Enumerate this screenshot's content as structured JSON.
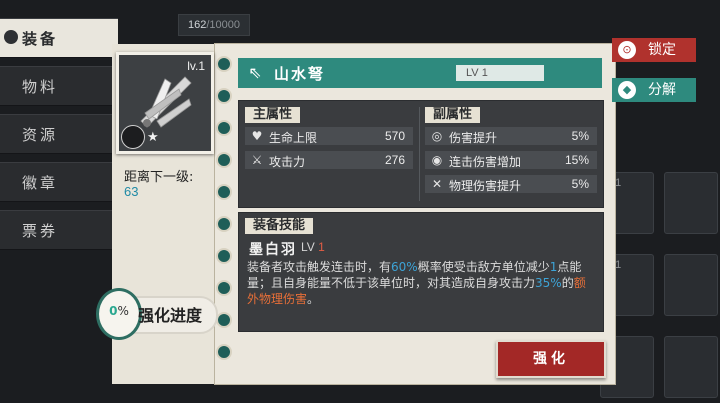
{
  "inventory": {
    "count": "162",
    "capacity": "/10000"
  },
  "sidebar": {
    "items": [
      {
        "label": "装备",
        "active": true
      },
      {
        "label": "物料"
      },
      {
        "label": "资源"
      },
      {
        "label": "徽章"
      },
      {
        "label": "票券"
      }
    ]
  },
  "item": {
    "card_level": "lv.1",
    "name": "山水弩",
    "level": "LV 1",
    "next_level_label": "距离下一级:",
    "next_level_value": "63"
  },
  "enhance_progress": {
    "percent": "0",
    "percent_sign": "%",
    "label": "强化进度"
  },
  "stats": {
    "main_title": "主属性",
    "sub_title": "副属性",
    "main": [
      {
        "icon": "heart-icon",
        "label": "生命上限",
        "value": "570"
      },
      {
        "icon": "swords-icon",
        "label": "攻击力",
        "value": "276"
      }
    ],
    "sub": [
      {
        "icon": "damage-boost-icon",
        "label": "伤害提升",
        "value": "5%"
      },
      {
        "icon": "combo-icon",
        "label": "连击伤害增加",
        "value": "15%"
      },
      {
        "icon": "physical-icon",
        "label": "物理伤害提升",
        "value": "5%"
      }
    ]
  },
  "skill": {
    "title": "装备技能",
    "name": "墨白羽",
    "lv_prefix": "LV ",
    "lv_num": "1",
    "desc_parts": {
      "p1": "装备者攻击触发连击时，有",
      "p2": "60%",
      "p3": "概率使受击敌方单位减少",
      "p4": "1",
      "p5": "点能量；且自身能量不低于该单位时，对其造成自身攻击力",
      "p6": "35%",
      "p7": "的",
      "p8": "额外物理伤害",
      "p9": "。"
    }
  },
  "buttons": {
    "enhance": "强化",
    "lock": "锁定",
    "decompose": "分解"
  },
  "background_slots": {
    "level_label": "lv.1"
  },
  "colors": {
    "teal": "#2e8a7e",
    "red": "#a32826",
    "paper": "#ebe7dd",
    "blue_highlight": "#3da3d6",
    "orange_highlight": "#e76f38"
  }
}
